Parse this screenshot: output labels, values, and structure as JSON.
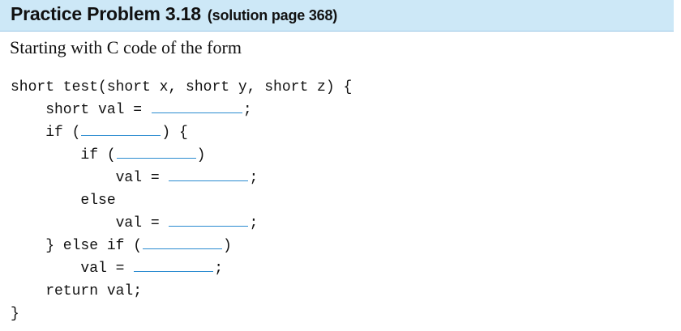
{
  "heading": {
    "title": "Practice Problem 3.18",
    "reference": "(solution page 368)"
  },
  "intro": "Starting with C code of the form",
  "code": {
    "l1": "short test(short x, short y, short z) {",
    "l2_pre": "    short val = ",
    "l2_post": ";",
    "l3_pre": "    if (",
    "l3_post": ") {",
    "l4_pre": "        if (",
    "l4_post": ")",
    "l5_pre": "            val = ",
    "l5_post": ";",
    "l6": "        else",
    "l7_pre": "            val = ",
    "l7_post": ";",
    "l8_pre": "    } else if (",
    "l8_post": ")",
    "l9_pre": "        val = ",
    "l9_post": ";",
    "l10": "    return val;",
    "l11": "}"
  },
  "colors": {
    "banner": "#cde8f7",
    "blank_line": "#2a8bd0"
  }
}
